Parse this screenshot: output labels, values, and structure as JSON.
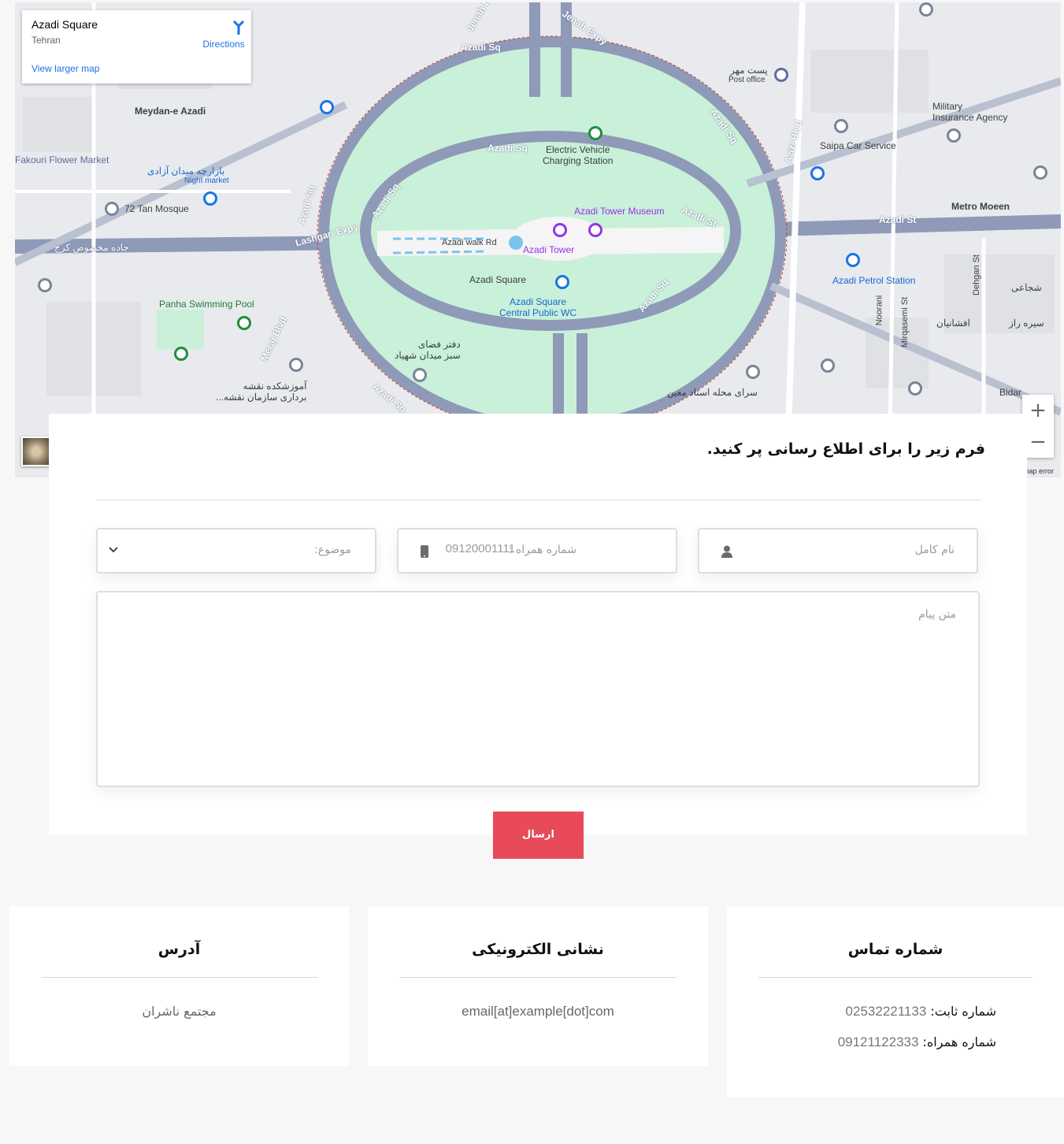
{
  "map": {
    "place_name": "Azadi Square",
    "place_city": "Tehran",
    "directions_label": "Directions",
    "view_larger_label": "View larger map",
    "zoom_in": "+",
    "zoom_out": "−",
    "report_label": "map error",
    "labels": {
      "azadi_sq_top": "Azadi Sq",
      "jenah_expy": "Jenah Expy",
      "azadi_sq_inner": "Azadi Sq",
      "ev_charging": "Electric Vehicle\nCharging Station",
      "azadi_tower_museum": "Azadi Tower Museum",
      "azadi_st_label": "Azadi St",
      "azadi_tower": "Azadi Tower",
      "azadi_walk_rd": "Azadi walk Rd",
      "azadi_square": "Azadi Square",
      "public_wc": "Azadi Square\nCentral Public WC",
      "lashgari_expy": "Lashgari Expy",
      "meydan_azadi": "Meydan-e Azadi",
      "fakouri": "Fakouri Flower Market",
      "night_market_fa": "بازارچه میدان آزادی",
      "night_market": "Night market",
      "tan_mosque": "72 Tan Mosque",
      "karaj_road_fa": "جاده مخصوص کرج",
      "panha_pool": "Panha Swimming Pool",
      "meraj_blvd": "Meraj Blvd",
      "naqsheh_fa": "آموزشکده نقشه\nبرداری سازمان نقشه...",
      "dafter_fa": "دفتر فضای\nسبز میدان شهیاد",
      "post_office_fa": "پست مهر",
      "post_office": "Post office",
      "azizi_blvd": "Azizi Blvd",
      "military_ins": "Military\nInsurance Agency",
      "saipa": "Saipa Car Service",
      "metro_moeen": "Metro Moeen",
      "azadi_st_east": "Azadi St",
      "azadi_petrol": "Azadi Petrol Station",
      "noorani": "Noorani",
      "mirqasemi": "Mirqasemi St",
      "dehgan": "Dehgan St",
      "shojaee_fa": "شجاعی",
      "afshan_fa": "افشانیان",
      "sorkh_fa": "سیره راز",
      "sara_fa": "سرای محله استاد معین",
      "bidar": "Bidar",
      "azadi_sq_east": "Azadi Sq",
      "azadi_sq_se": "Azadi Sq",
      "azadi_sq_west": "Azadi Sq",
      "azadi_sq_bottom": "Azadi Sq"
    }
  },
  "form": {
    "title": "فرم زیر را برای اطلاع رسانی پر کنید.",
    "name_placeholder": "نام کامل",
    "phone_placeholder": "شماره همراه :",
    "phone_example": "09120001111",
    "subject_placeholder": "موضوع:",
    "message_placeholder": "متن پیام",
    "submit_label": "ارسال"
  },
  "cards": {
    "address": {
      "title": "آدرس",
      "value": "مجتمع ناشران"
    },
    "email": {
      "title": "نشانی الکترونیکی",
      "value": "email[at]example[dot]com"
    },
    "phone": {
      "title": "شماره تماس",
      "landline_label": "شماره ثابت:",
      "landline_value": "02532221133",
      "mobile_label": "شماره همراه:",
      "mobile_value": "09121122333"
    }
  },
  "colors": {
    "accent": "#e84a5a",
    "park": "#c9f0d9",
    "road": "#8e9ab8",
    "map_bg": "#e8eaed"
  }
}
